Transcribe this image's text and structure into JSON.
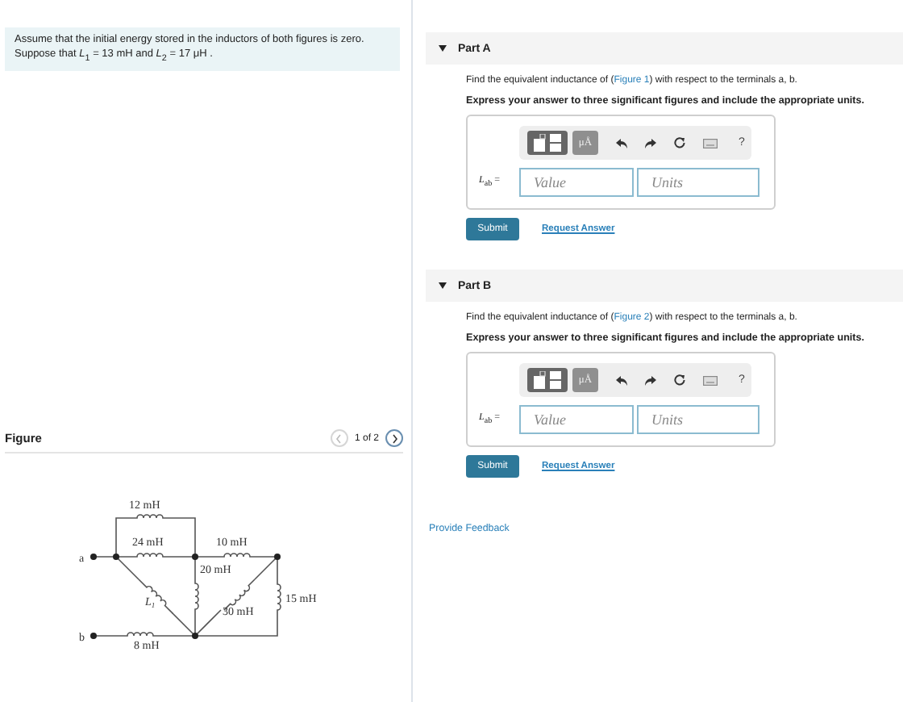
{
  "problem": {
    "text": "Assume that the initial energy stored in the inductors of both figures is zero.",
    "given": "Suppose that *L*$_{1}$ = 13 mH and *L*$_{2}$ = 17 μH ."
  },
  "figure": {
    "title": "Figure",
    "pager": "1 of 2",
    "labels": [
      {
        "kind": "value",
        "text": "12 mH"
      },
      {
        "kind": "value",
        "text": "24 mH"
      },
      {
        "kind": "value",
        "text": "10 mH"
      },
      {
        "kind": "value",
        "text": "20 mH"
      },
      {
        "kind": "value",
        "text": "15 mH"
      },
      {
        "kind": "value",
        "text": "30 mH"
      },
      {
        "kind": "value",
        "text": "8 mH"
      },
      {
        "kind": "terminal",
        "text": "a"
      },
      {
        "kind": "terminal",
        "text": "b"
      },
      {
        "kind": "symbol",
        "text": "L",
        "sub": "1"
      }
    ]
  },
  "parts": [
    {
      "title": "Part A",
      "expanded": true,
      "prompt_before": "Find the equivalent inductance of (",
      "link": "Figure 1",
      "prompt_after": ") with respect to the terminals a, b.",
      "instruction": "Express your answer to three significant figures and include the appropriate units.",
      "units_button": "μÅ",
      "help": "?",
      "variable": "*L*$_{ab}$ =",
      "value_placeholder": "Value",
      "units_placeholder": "Units",
      "submit": "Submit",
      "request": "Request Answer"
    },
    {
      "title": "Part B",
      "expanded": true,
      "prompt_before": "Find the equivalent inductance of (",
      "link": "Figure 2",
      "prompt_after": ") with respect to the terminals a, b.",
      "instruction": "Express your answer to three significant figures and include the appropriate units.",
      "units_button": "μÅ",
      "help": "?",
      "variable": "*L*$_{ab}$ =",
      "value_placeholder": "Value",
      "units_placeholder": "Units",
      "submit": "Submit",
      "request": "Request Answer"
    }
  ],
  "feedback": "Provide Feedback"
}
